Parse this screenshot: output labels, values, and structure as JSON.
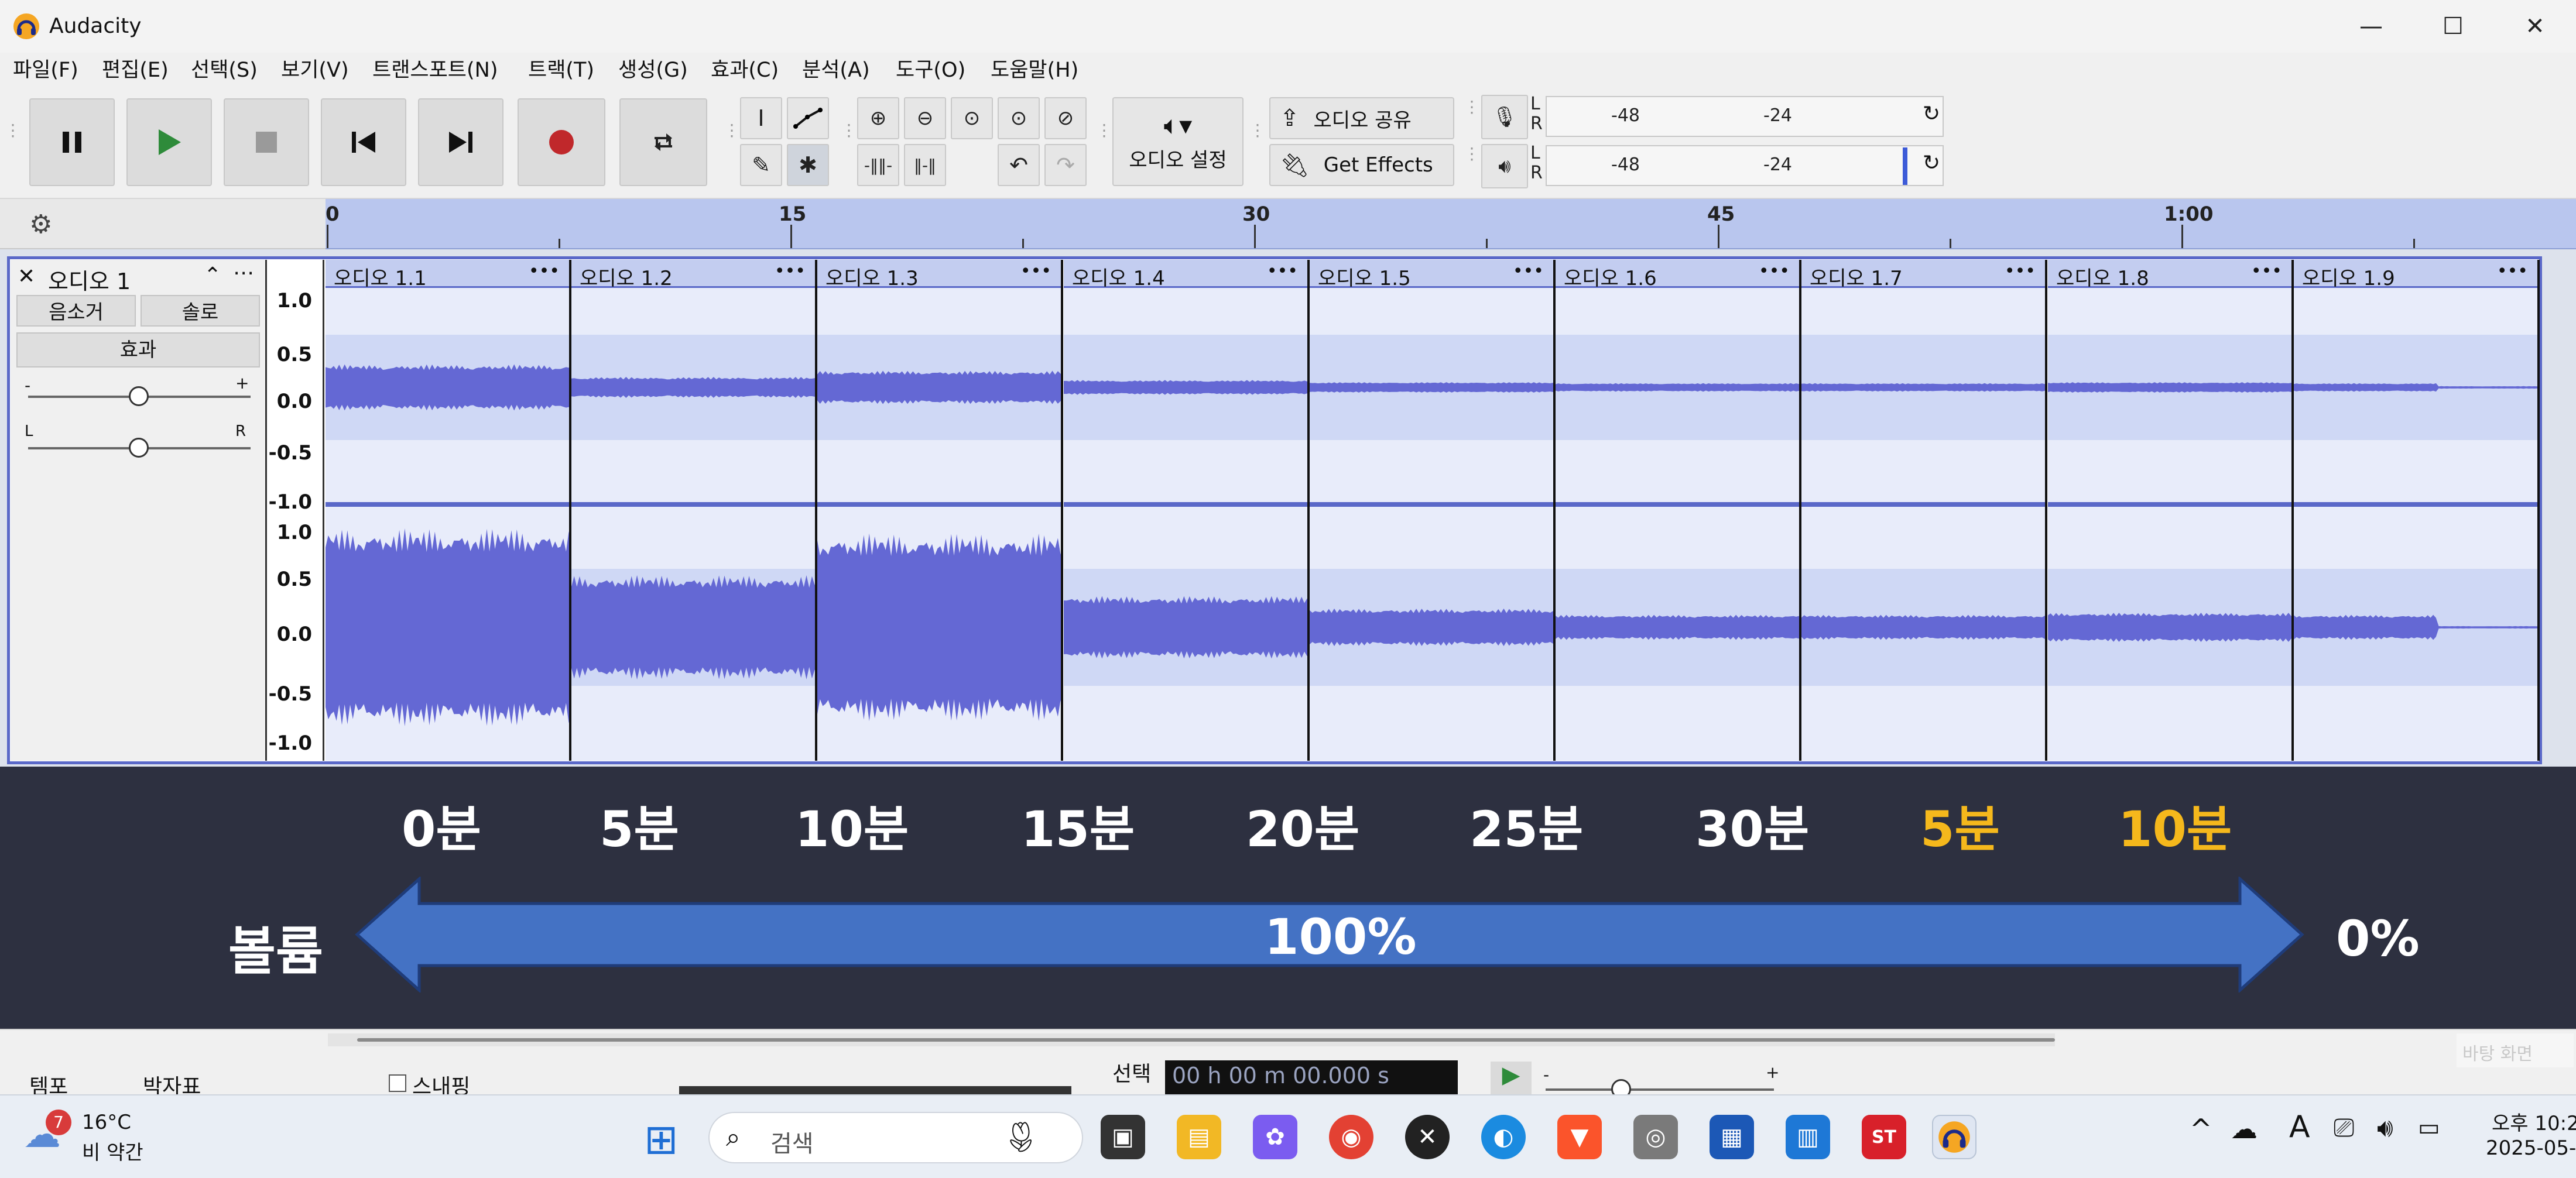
{
  "window": {
    "title": "Audacity",
    "minimize": "—",
    "maximize": "☐",
    "close": "✕"
  },
  "menu": [
    {
      "label": "파일(F)"
    },
    {
      "label": "편집(E)"
    },
    {
      "label": "선택(S)"
    },
    {
      "label": "보기(V)"
    },
    {
      "label": "트랜스포트(N)"
    },
    {
      "label": "트랙(T)"
    },
    {
      "label": "생성(G)"
    },
    {
      "label": "효과(C)"
    },
    {
      "label": "분석(A)"
    },
    {
      "label": "도구(O)"
    },
    {
      "label": "도움말(H)"
    }
  ],
  "toolbar": {
    "audio_setup": "오디오 설정",
    "share_audio": "오디오 공유",
    "get_effects": "Get Effects",
    "meter_ticks": [
      "-48",
      "-24"
    ],
    "meter_channels": [
      "L",
      "R"
    ],
    "playback_level": 0.9
  },
  "ruler": {
    "ticks": [
      "0",
      "15",
      "30",
      "45",
      "1:00"
    ]
  },
  "track": {
    "name": "오디오 1",
    "mute": "음소거",
    "solo": "솔로",
    "effects": "효과",
    "gain_minus": "-",
    "gain_plus": "+",
    "pan_left": "L",
    "pan_right": "R",
    "scale_top": [
      "1.0",
      "0.5",
      "0.0",
      "-0.5",
      "-1.0"
    ],
    "scale_bottom": [
      "1.0",
      "0.5",
      "0.0",
      "-0.5",
      "-1.0"
    ]
  },
  "clips": [
    {
      "name": "오디오 1.1",
      "menu": "•••",
      "amp_top": 0.22,
      "amp_bottom": 0.95
    },
    {
      "name": "오디오 1.2",
      "menu": "•••",
      "amp_top": 0.1,
      "amp_bottom": 0.5
    },
    {
      "name": "오디오 1.3",
      "menu": "•••",
      "amp_top": 0.16,
      "amp_bottom": 0.9
    },
    {
      "name": "오디오 1.4",
      "menu": "•••",
      "amp_top": 0.07,
      "amp_bottom": 0.3
    },
    {
      "name": "오디오 1.5",
      "menu": "•••",
      "amp_top": 0.05,
      "amp_bottom": 0.18
    },
    {
      "name": "오디오 1.6",
      "menu": "•••",
      "amp_top": 0.04,
      "amp_bottom": 0.12
    },
    {
      "name": "오디오 1.7",
      "menu": "•••",
      "amp_top": 0.04,
      "amp_bottom": 0.12
    },
    {
      "name": "오디오 1.8",
      "menu": "•••",
      "amp_top": 0.05,
      "amp_bottom": 0.14
    },
    {
      "name": "오디오 1.9",
      "menu": "•••",
      "amp_top": 0.04,
      "amp_bottom": 0.12
    }
  ],
  "overlay": {
    "minutes": [
      {
        "label": "0분",
        "highlight": false
      },
      {
        "label": "5분",
        "highlight": false
      },
      {
        "label": "10분",
        "highlight": false
      },
      {
        "label": "15분",
        "highlight": false
      },
      {
        "label": "20분",
        "highlight": false
      },
      {
        "label": "25분",
        "highlight": false
      },
      {
        "label": "30분",
        "highlight": false
      },
      {
        "label": "5분",
        "highlight": true
      },
      {
        "label": "10분",
        "highlight": true
      }
    ],
    "volume_label": "볼륨",
    "arrow_text": "100%",
    "end_label": "0%",
    "highlight_color": "#f5b81c"
  },
  "bottom": {
    "tempo": "템포",
    "time_sig": "박자표",
    "snap": "스내핑",
    "selection": "선택",
    "time_value": "00 h 00 m 00.000 s",
    "corner_text": "바탕 화면"
  },
  "taskbar": {
    "weather_badge": "7",
    "temp": "16°C",
    "weather": "비 약간",
    "search_placeholder": "검색",
    "clock_time": "오후 10:2",
    "clock_date": "2025-05-0",
    "ime": "A"
  },
  "colors": {
    "waveform": "#6468d4",
    "waveform_bg": "#e8ecfa",
    "band": "#cfd8f5",
    "selection": "#5a68c8"
  }
}
